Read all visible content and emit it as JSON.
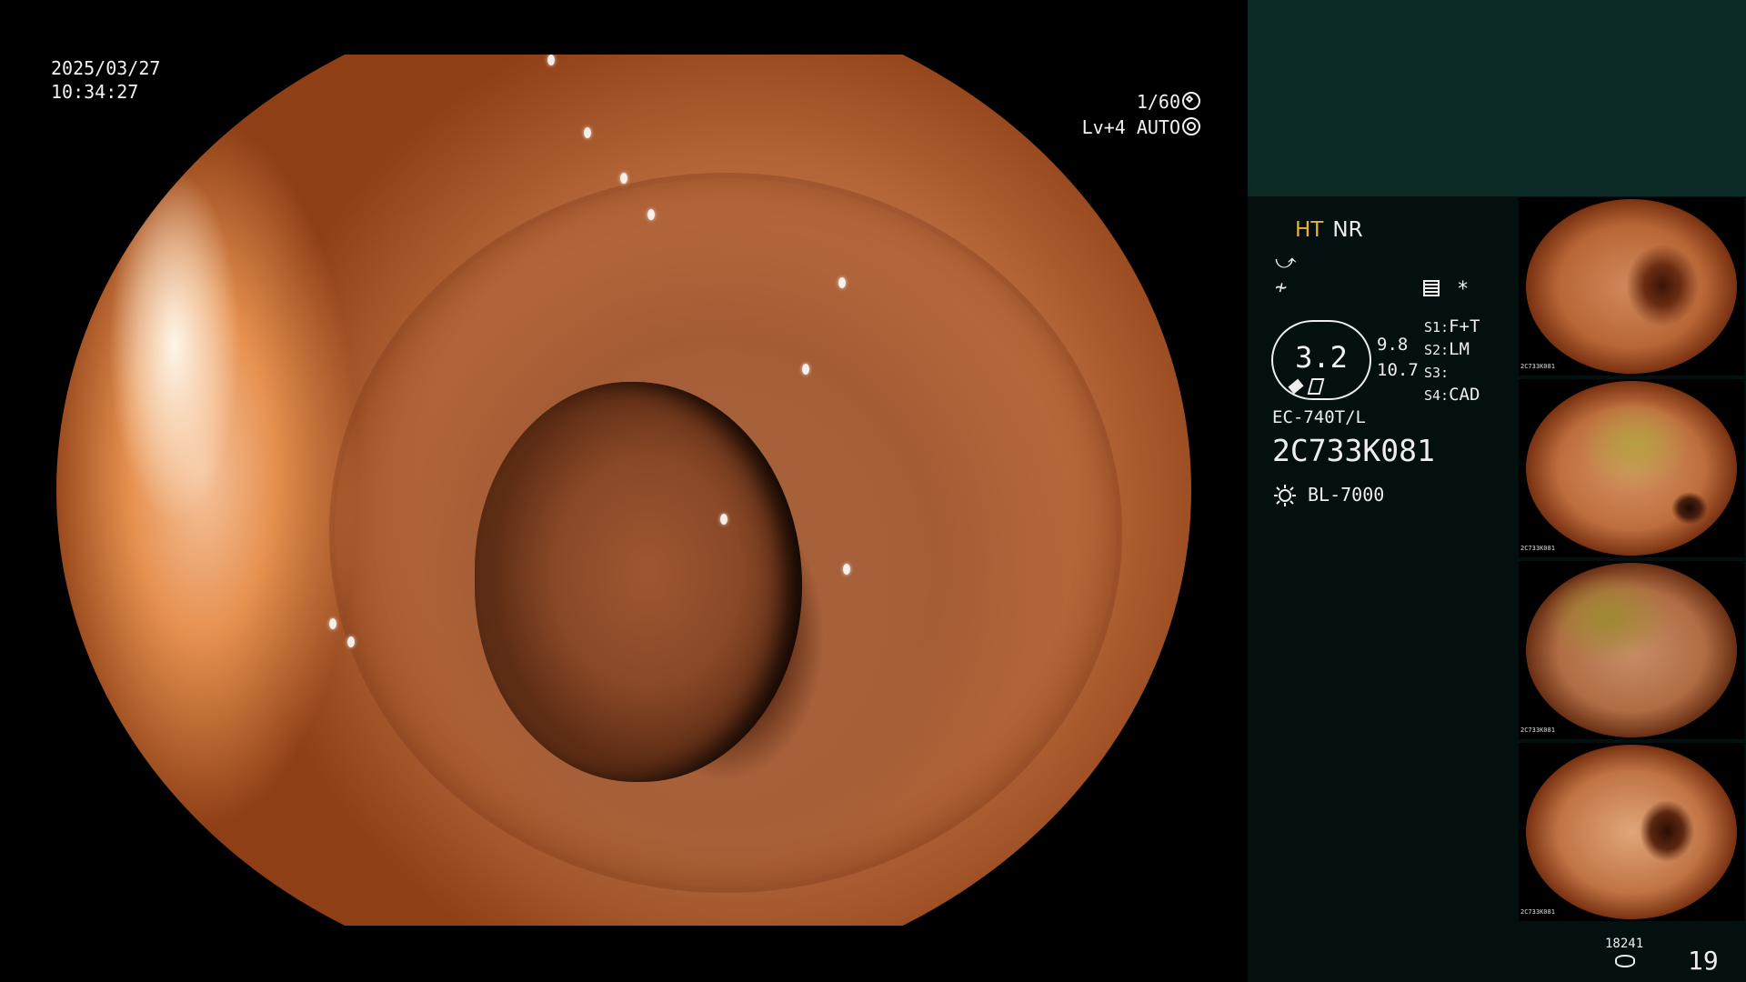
{
  "main_view": {
    "date": "2025/03/27",
    "time": "10:34:27",
    "shutter": "1/60",
    "shutter_icon": "aperture-icon",
    "level_mode": "Lv+4 AUTO",
    "auto_icon": "auto-exposure-icon"
  },
  "side_panel": {
    "ht_label": "HT",
    "nr_label": "NR",
    "structure_icon": "structure-enhance-icon",
    "contrast_icon": "contrast-icon",
    "menu_icon": "menu-icon",
    "star": "*",
    "gauge_value": "3.2",
    "sub_values": [
      "9.8",
      "10.7"
    ],
    "switches": [
      {
        "key": "S1:",
        "value": "F+T"
      },
      {
        "key": "S2:",
        "value": "LM"
      },
      {
        "key": "S3:",
        "value": ""
      },
      {
        "key": "S4:",
        "value": "CAD"
      }
    ],
    "scope_model": "EC-740T/L",
    "scope_serial": "2C733K081",
    "light_icon": "light-source-icon",
    "light_source": "BL-7000",
    "thumbnails": [
      {
        "caption": "2C733K081"
      },
      {
        "caption": "2C733K081"
      },
      {
        "caption": "2C733K081"
      },
      {
        "caption": "2C733K081"
      }
    ],
    "counter": "18241",
    "storage_icon": "storage-icon",
    "image_count": "19"
  }
}
